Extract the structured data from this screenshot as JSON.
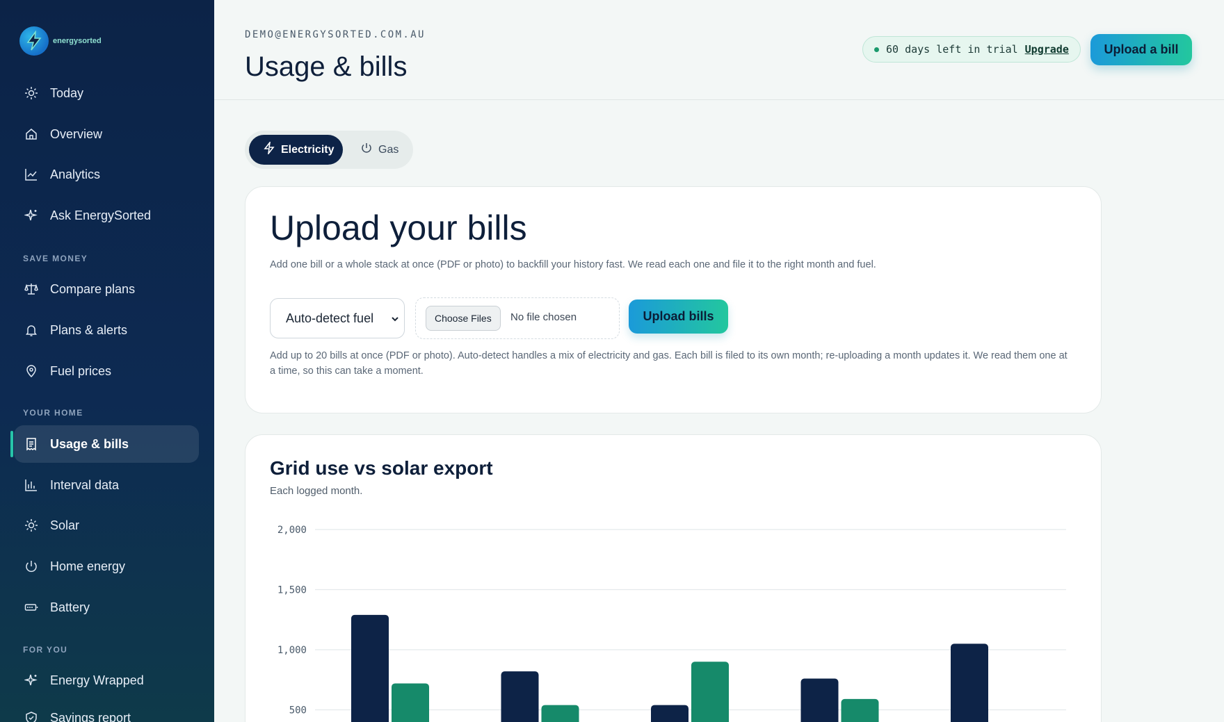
{
  "brand": {
    "name": "energysorted"
  },
  "sidebar": {
    "items_top": [
      {
        "label": "Today",
        "icon": "sun-icon"
      },
      {
        "label": "Overview",
        "icon": "home-icon"
      },
      {
        "label": "Analytics",
        "icon": "chart-line-icon"
      },
      {
        "label": "Ask EnergySorted",
        "icon": "sparkle-icon"
      }
    ],
    "save_money_label": "SAVE MONEY",
    "items_save": [
      {
        "label": "Compare plans",
        "icon": "scale-icon"
      },
      {
        "label": "Plans & alerts",
        "icon": "bell-icon"
      },
      {
        "label": "Fuel prices",
        "icon": "map-pin-icon"
      }
    ],
    "your_home_label": "YOUR HOME",
    "items_home": [
      {
        "label": "Usage & bills",
        "icon": "receipt-icon",
        "active": true
      },
      {
        "label": "Interval data",
        "icon": "bar-chart-icon"
      },
      {
        "label": "Solar",
        "icon": "sun-icon"
      },
      {
        "label": "Home energy",
        "icon": "power-icon"
      },
      {
        "label": "Battery",
        "icon": "battery-icon"
      }
    ],
    "for_you_label": "FOR YOU",
    "items_you": [
      {
        "label": "Energy Wrapped",
        "icon": "sparkle-icon"
      },
      {
        "label": "Savings report",
        "icon": "shield-icon"
      }
    ]
  },
  "header": {
    "email": "DEMO@ENERGYSORTED.COM.AU",
    "title": "Usage & bills",
    "trial_text": "60 days left in trial",
    "upgrade_label": "Upgrade",
    "upload_label": "Upload a bill"
  },
  "tabs": {
    "electricity": "Electricity",
    "gas": "Gas"
  },
  "upload_card": {
    "title": "Upload your bills",
    "description": "Add one bill or a whole stack at once (PDF or photo) to backfill your history fast. We read each one and file it to the right month and fuel.",
    "fuel_select_value": "Auto-detect fuel",
    "choose_files_label": "Choose Files",
    "no_file_text": "No file chosen",
    "upload_button": "Upload bills",
    "hint": "Add up to 20 bills at once (PDF or photo). Auto-detect handles a mix of electricity and gas. Each bill is filed to its own month; re-uploading a month updates it. We read them one at a time, so this can take a moment."
  },
  "chart_card": {
    "title": "Grid use vs solar export",
    "subtitle": "Each logged month."
  },
  "colors": {
    "grid_use": "#0d2347",
    "solar_export": "#168a6a",
    "accent_from": "#1b9ad9",
    "accent_to": "#23c79e"
  },
  "chart_data": {
    "type": "bar",
    "title": "Grid use vs solar export",
    "subtitle": "Each logged month.",
    "ylim": [
      0,
      2000
    ],
    "yticks": [
      "2,000",
      "1,500",
      "1,000",
      "500"
    ],
    "ytick_values": [
      2000,
      1500,
      1000,
      500
    ],
    "grid": true,
    "series": [
      {
        "values": [
          1290,
          820,
          540,
          760,
          1050
        ]
      },
      {
        "values": [
          720,
          540,
          900,
          590,
          null
        ]
      }
    ]
  }
}
